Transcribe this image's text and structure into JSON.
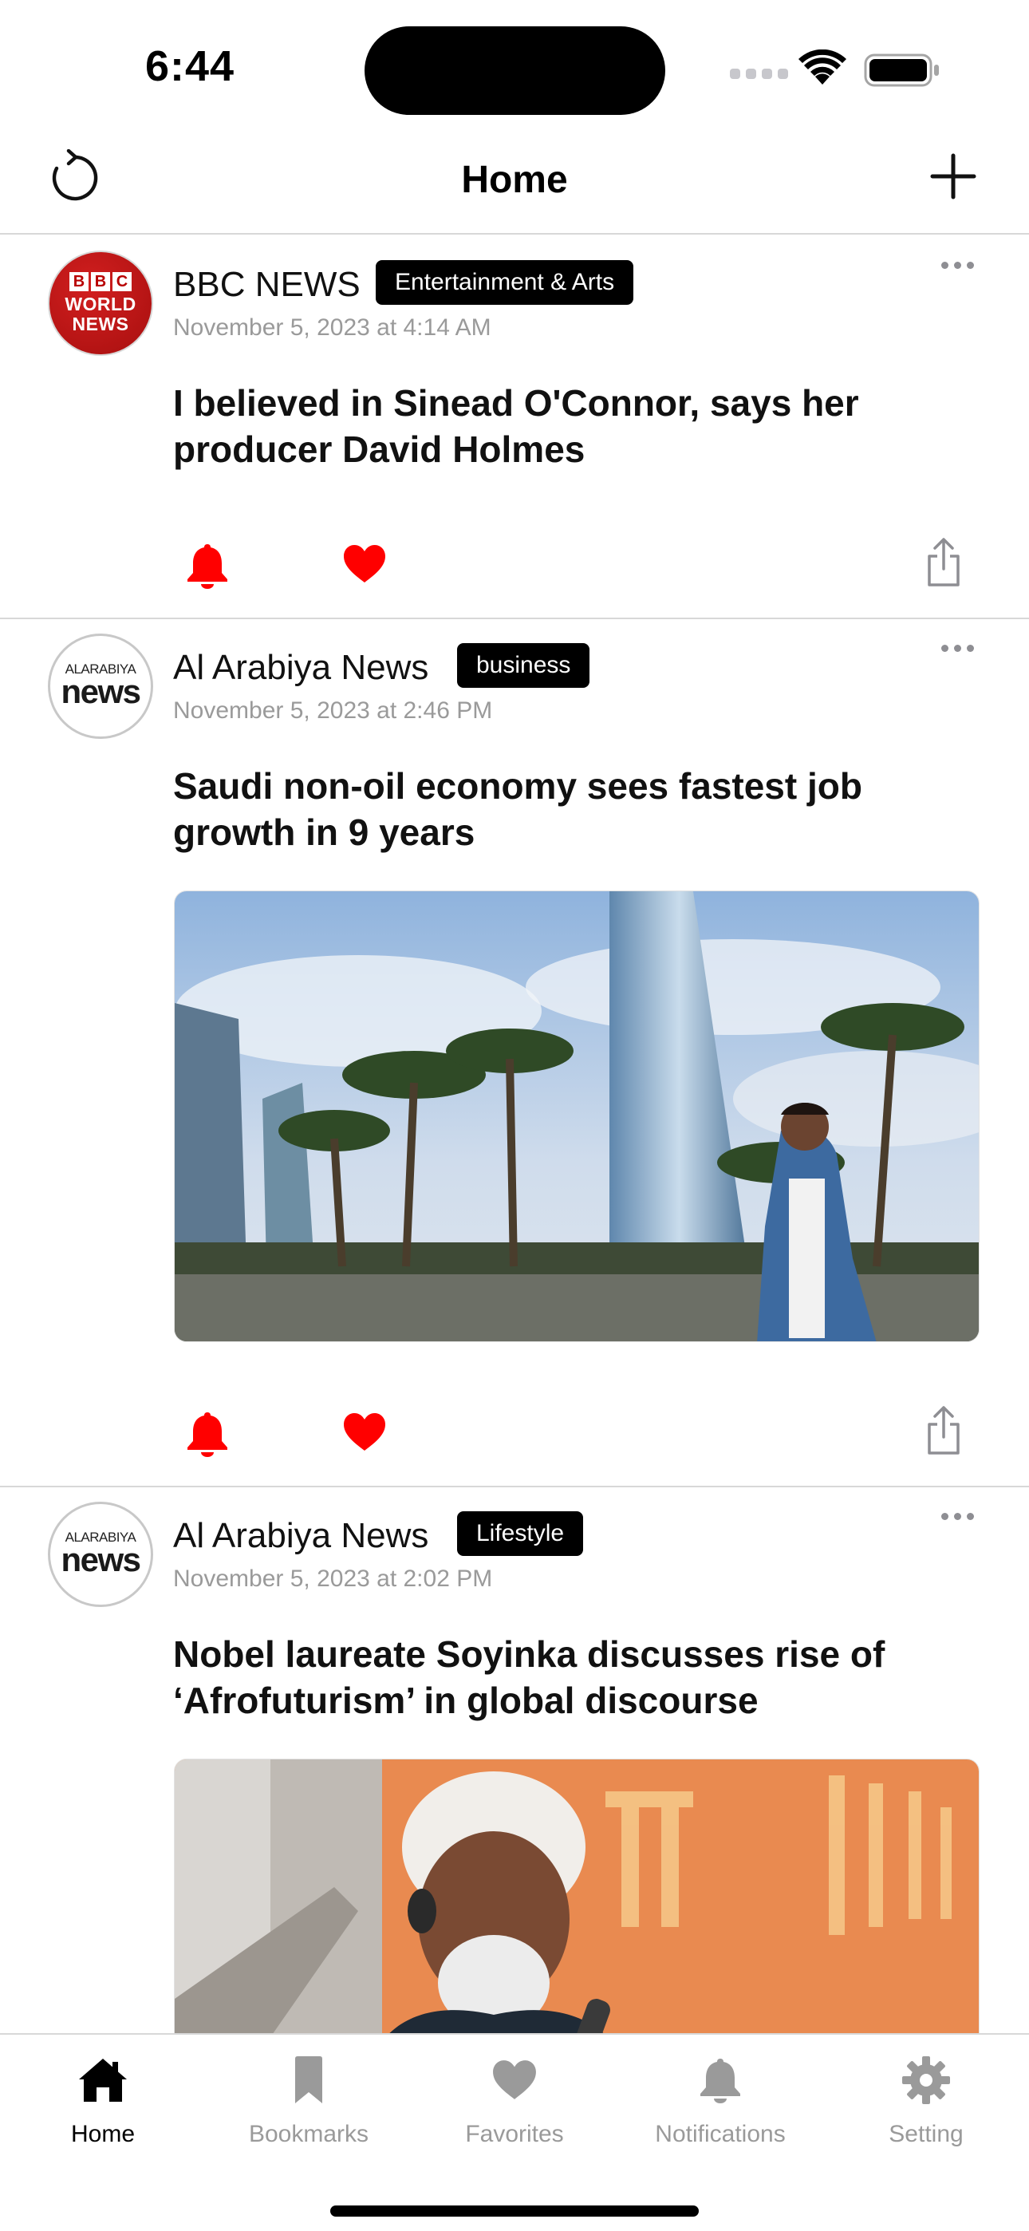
{
  "status_bar": {
    "time": "6:44"
  },
  "nav": {
    "title": "Home"
  },
  "colors": {
    "accent": "#ff0000",
    "badge": "#000000",
    "muted": "#9a9a9a"
  },
  "posts": [
    {
      "source": "BBC NEWS",
      "avatar_text": [
        "BBC",
        "WORLD",
        "NEWS"
      ],
      "category": "Entertainment & Arts",
      "timestamp": "November 5, 2023 at 4:14 AM",
      "headline": "I believed in Sinead O'Connor, says her producer David Holmes",
      "has_image": false
    },
    {
      "source": "Al Arabiya News",
      "avatar_text": [
        "ALARABIYA",
        "news"
      ],
      "category": "business",
      "timestamp": "November 5, 2023 at 2:46 PM",
      "headline": "Saudi non-oil economy sees fastest job growth in 9 years",
      "has_image": true
    },
    {
      "source": "Al Arabiya News",
      "avatar_text": [
        "ALARABIYA",
        "news"
      ],
      "category": "Lifestyle",
      "timestamp": "November 5, 2023 at 2:02 PM",
      "headline": "Nobel laureate Soyinka discusses rise of ‘Afrofuturism’ in global discourse",
      "has_image": true
    }
  ],
  "tabs": [
    {
      "label": "Home",
      "icon": "house-icon",
      "active": true
    },
    {
      "label": "Bookmarks",
      "icon": "bookmark-icon",
      "active": false
    },
    {
      "label": "Favorites",
      "icon": "heart-icon",
      "active": false
    },
    {
      "label": "Notifications",
      "icon": "bell-icon",
      "active": false
    },
    {
      "label": "Setting",
      "icon": "gear-icon",
      "active": false
    }
  ]
}
